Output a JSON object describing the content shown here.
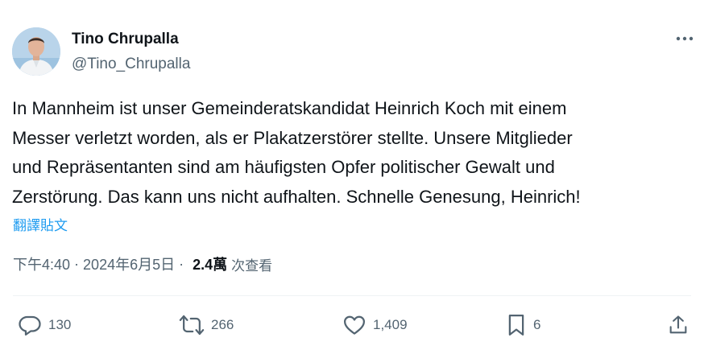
{
  "author": {
    "name": "Tino Chrupalla",
    "handle": "@Tino_Chrupalla"
  },
  "tweet": {
    "lines": [
      "In Mannheim ist unser Gemeinderatskandidat Heinrich Koch mit einem",
      "Messer verletzt worden, als er Plakatzerstörer stellte. Unsere Mitglieder",
      "und Repräsentanten sind am häufigsten Opfer politischer Gewalt und",
      "Zerstörung. Das kann uns nicht aufhalten. Schnelle Genesung, Heinrich!"
    ],
    "translate_label": "翻譯貼文"
  },
  "meta": {
    "time": "下午4:40",
    "separator": "·",
    "date": "2024年6月5日",
    "views_count": "2.4萬",
    "views_label": "次查看"
  },
  "actions": {
    "replies": "130",
    "reposts": "266",
    "likes": "1,409",
    "bookmarks": "6"
  },
  "colors": {
    "text": "#0f1419",
    "secondary": "#536471",
    "link": "#1d9bf0",
    "divider": "#eff3f4"
  }
}
